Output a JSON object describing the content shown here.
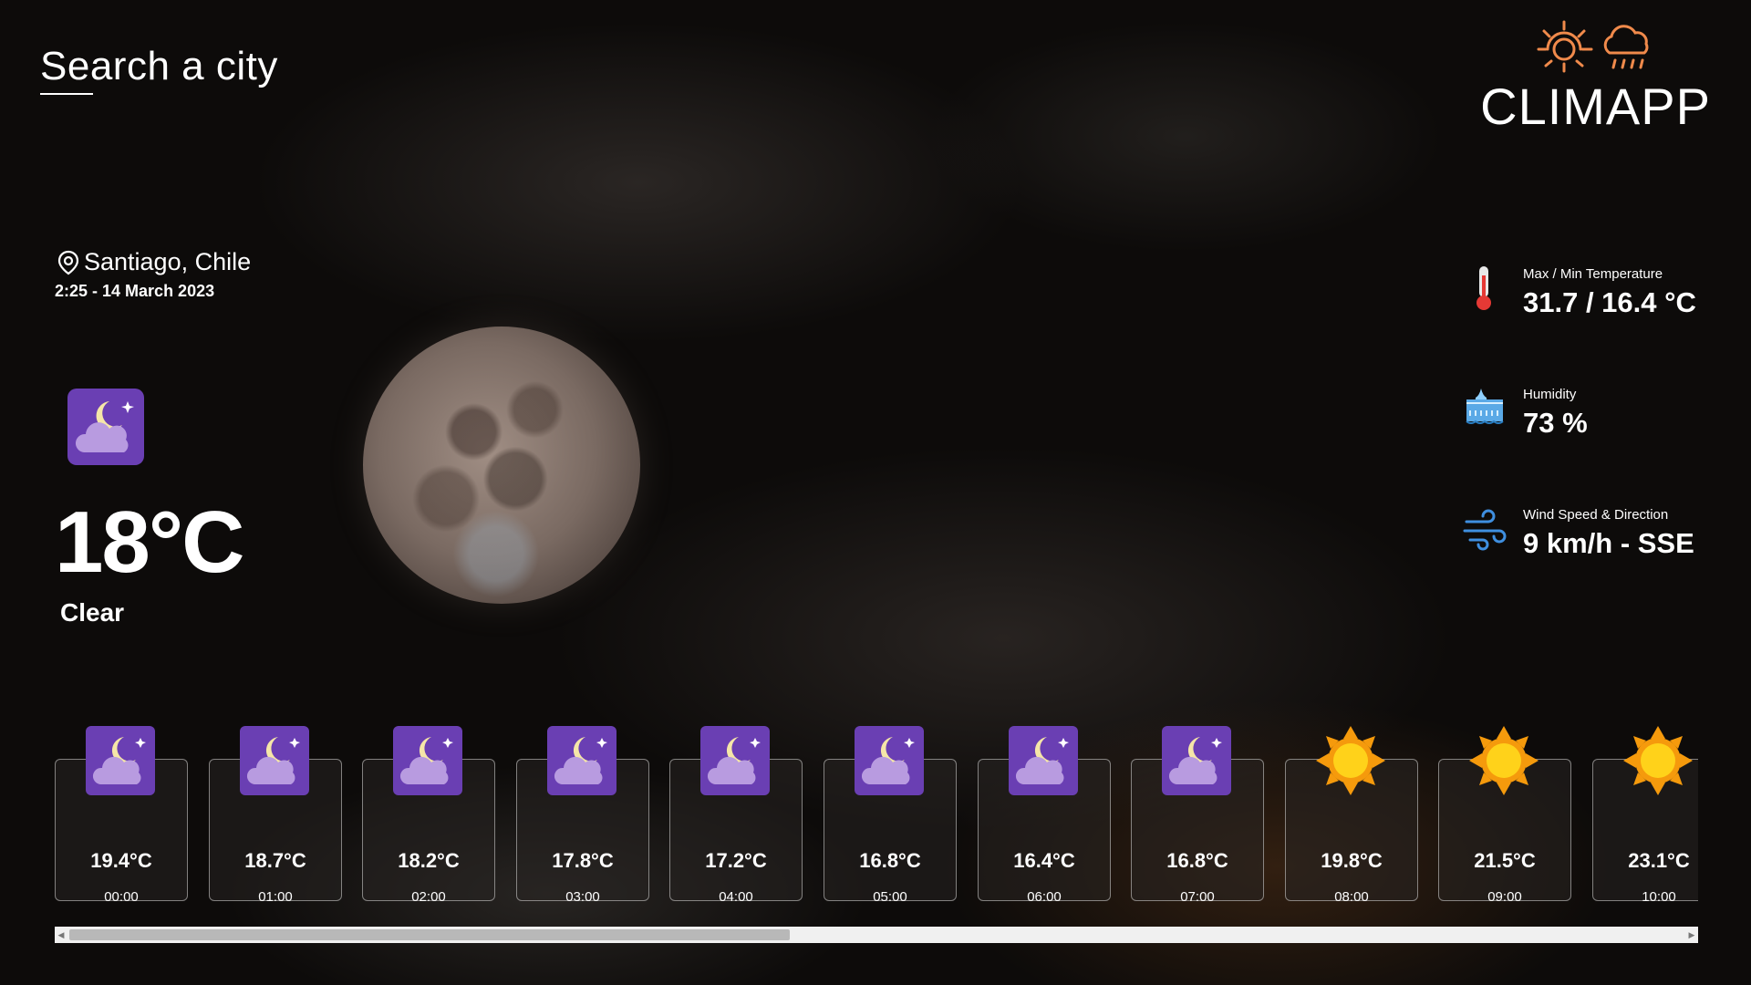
{
  "search": {
    "label": "Search a city"
  },
  "brand": {
    "name": "CLIMAPP",
    "icons": [
      "sun-icon",
      "cloud-rain-icon"
    ],
    "accent": "#f08a4b"
  },
  "location": {
    "city": "Santiago, Chile",
    "datetime": "2:25 - 14 March 2023",
    "icon": "location-pin-icon"
  },
  "current": {
    "temperature": "18°C",
    "condition": "Clear",
    "icon": "night-cloud-icon"
  },
  "stats": [
    {
      "label": "Max / Min Temperature",
      "value": "31.7 / 16.4 °C",
      "icon": "thermometer-icon"
    },
    {
      "label": "Humidity",
      "value": "73 %",
      "icon": "humidity-icon"
    },
    {
      "label": "Wind Speed & Direction",
      "value": "9 km/h - SSE",
      "icon": "wind-icon"
    }
  ],
  "hourly": [
    {
      "temp": "19.4°C",
      "time": "00:00",
      "icon": "night-cloud-icon"
    },
    {
      "temp": "18.7°C",
      "time": "01:00",
      "icon": "night-cloud-icon"
    },
    {
      "temp": "18.2°C",
      "time": "02:00",
      "icon": "night-cloud-icon"
    },
    {
      "temp": "17.8°C",
      "time": "03:00",
      "icon": "night-cloud-icon"
    },
    {
      "temp": "17.2°C",
      "time": "04:00",
      "icon": "night-cloud-icon"
    },
    {
      "temp": "16.8°C",
      "time": "05:00",
      "icon": "night-cloud-icon"
    },
    {
      "temp": "16.4°C",
      "time": "06:00",
      "icon": "night-cloud-icon"
    },
    {
      "temp": "16.8°C",
      "time": "07:00",
      "icon": "night-cloud-icon"
    },
    {
      "temp": "19.8°C",
      "time": "08:00",
      "icon": "sun-icon"
    },
    {
      "temp": "21.5°C",
      "time": "09:00",
      "icon": "sun-icon"
    },
    {
      "temp": "23.1°C",
      "time": "10:00",
      "icon": "sun-icon"
    }
  ],
  "colors": {
    "night_icon_bg": "#6a3fb3",
    "cloud": "#b89be0",
    "moon_icon": "#f5e6a8",
    "sun": "#ffd21a",
    "sun_rays": "#f59a0c"
  }
}
